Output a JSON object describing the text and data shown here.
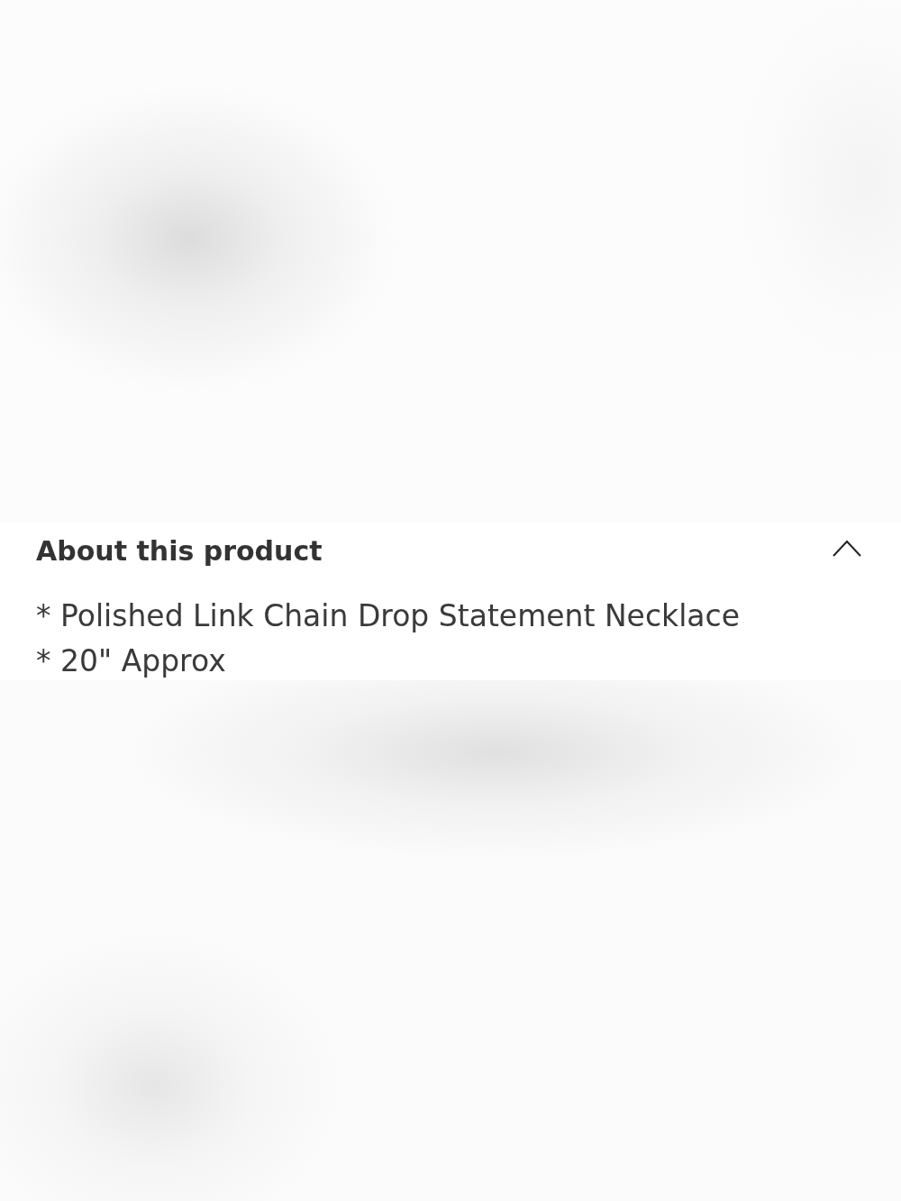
{
  "section": {
    "title": "About this product",
    "expanded": true,
    "lines": [
      "* Polished Link Chain Drop Statement Necklace",
      "* 20\" Approx"
    ]
  }
}
